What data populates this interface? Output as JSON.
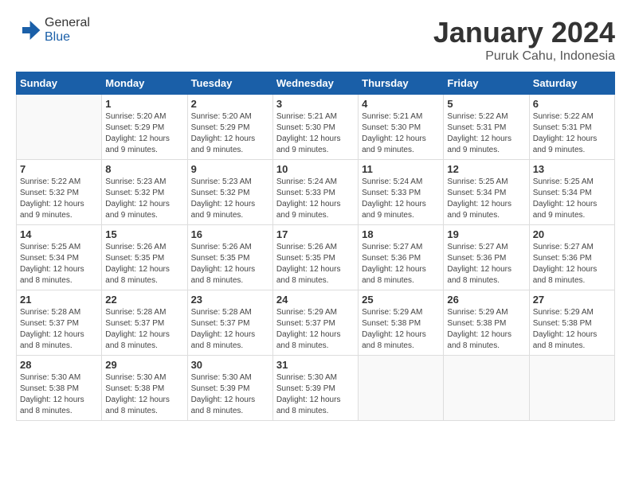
{
  "logo": {
    "general": "General",
    "blue": "Blue"
  },
  "title": {
    "month": "January 2024",
    "location": "Puruk Cahu, Indonesia"
  },
  "weekdays": [
    "Sunday",
    "Monday",
    "Tuesday",
    "Wednesday",
    "Thursday",
    "Friday",
    "Saturday"
  ],
  "weeks": [
    [
      {
        "day": null
      },
      {
        "day": "1",
        "sunrise": "5:20 AM",
        "sunset": "5:29 PM",
        "daylight": "12 hours and 9 minutes."
      },
      {
        "day": "2",
        "sunrise": "5:20 AM",
        "sunset": "5:29 PM",
        "daylight": "12 hours and 9 minutes."
      },
      {
        "day": "3",
        "sunrise": "5:21 AM",
        "sunset": "5:30 PM",
        "daylight": "12 hours and 9 minutes."
      },
      {
        "day": "4",
        "sunrise": "5:21 AM",
        "sunset": "5:30 PM",
        "daylight": "12 hours and 9 minutes."
      },
      {
        "day": "5",
        "sunrise": "5:22 AM",
        "sunset": "5:31 PM",
        "daylight": "12 hours and 9 minutes."
      },
      {
        "day": "6",
        "sunrise": "5:22 AM",
        "sunset": "5:31 PM",
        "daylight": "12 hours and 9 minutes."
      }
    ],
    [
      {
        "day": "7",
        "sunrise": "5:22 AM",
        "sunset": "5:32 PM",
        "daylight": "12 hours and 9 minutes."
      },
      {
        "day": "8",
        "sunrise": "5:23 AM",
        "sunset": "5:32 PM",
        "daylight": "12 hours and 9 minutes."
      },
      {
        "day": "9",
        "sunrise": "5:23 AM",
        "sunset": "5:32 PM",
        "daylight": "12 hours and 9 minutes."
      },
      {
        "day": "10",
        "sunrise": "5:24 AM",
        "sunset": "5:33 PM",
        "daylight": "12 hours and 9 minutes."
      },
      {
        "day": "11",
        "sunrise": "5:24 AM",
        "sunset": "5:33 PM",
        "daylight": "12 hours and 9 minutes."
      },
      {
        "day": "12",
        "sunrise": "5:25 AM",
        "sunset": "5:34 PM",
        "daylight": "12 hours and 9 minutes."
      },
      {
        "day": "13",
        "sunrise": "5:25 AM",
        "sunset": "5:34 PM",
        "daylight": "12 hours and 9 minutes."
      }
    ],
    [
      {
        "day": "14",
        "sunrise": "5:25 AM",
        "sunset": "5:34 PM",
        "daylight": "12 hours and 8 minutes."
      },
      {
        "day": "15",
        "sunrise": "5:26 AM",
        "sunset": "5:35 PM",
        "daylight": "12 hours and 8 minutes."
      },
      {
        "day": "16",
        "sunrise": "5:26 AM",
        "sunset": "5:35 PM",
        "daylight": "12 hours and 8 minutes."
      },
      {
        "day": "17",
        "sunrise": "5:26 AM",
        "sunset": "5:35 PM",
        "daylight": "12 hours and 8 minutes."
      },
      {
        "day": "18",
        "sunrise": "5:27 AM",
        "sunset": "5:36 PM",
        "daylight": "12 hours and 8 minutes."
      },
      {
        "day": "19",
        "sunrise": "5:27 AM",
        "sunset": "5:36 PM",
        "daylight": "12 hours and 8 minutes."
      },
      {
        "day": "20",
        "sunrise": "5:27 AM",
        "sunset": "5:36 PM",
        "daylight": "12 hours and 8 minutes."
      }
    ],
    [
      {
        "day": "21",
        "sunrise": "5:28 AM",
        "sunset": "5:37 PM",
        "daylight": "12 hours and 8 minutes."
      },
      {
        "day": "22",
        "sunrise": "5:28 AM",
        "sunset": "5:37 PM",
        "daylight": "12 hours and 8 minutes."
      },
      {
        "day": "23",
        "sunrise": "5:28 AM",
        "sunset": "5:37 PM",
        "daylight": "12 hours and 8 minutes."
      },
      {
        "day": "24",
        "sunrise": "5:29 AM",
        "sunset": "5:37 PM",
        "daylight": "12 hours and 8 minutes."
      },
      {
        "day": "25",
        "sunrise": "5:29 AM",
        "sunset": "5:38 PM",
        "daylight": "12 hours and 8 minutes."
      },
      {
        "day": "26",
        "sunrise": "5:29 AM",
        "sunset": "5:38 PM",
        "daylight": "12 hours and 8 minutes."
      },
      {
        "day": "27",
        "sunrise": "5:29 AM",
        "sunset": "5:38 PM",
        "daylight": "12 hours and 8 minutes."
      }
    ],
    [
      {
        "day": "28",
        "sunrise": "5:30 AM",
        "sunset": "5:38 PM",
        "daylight": "12 hours and 8 minutes."
      },
      {
        "day": "29",
        "sunrise": "5:30 AM",
        "sunset": "5:38 PM",
        "daylight": "12 hours and 8 minutes."
      },
      {
        "day": "30",
        "sunrise": "5:30 AM",
        "sunset": "5:39 PM",
        "daylight": "12 hours and 8 minutes."
      },
      {
        "day": "31",
        "sunrise": "5:30 AM",
        "sunset": "5:39 PM",
        "daylight": "12 hours and 8 minutes."
      },
      {
        "day": null
      },
      {
        "day": null
      },
      {
        "day": null
      }
    ]
  ]
}
